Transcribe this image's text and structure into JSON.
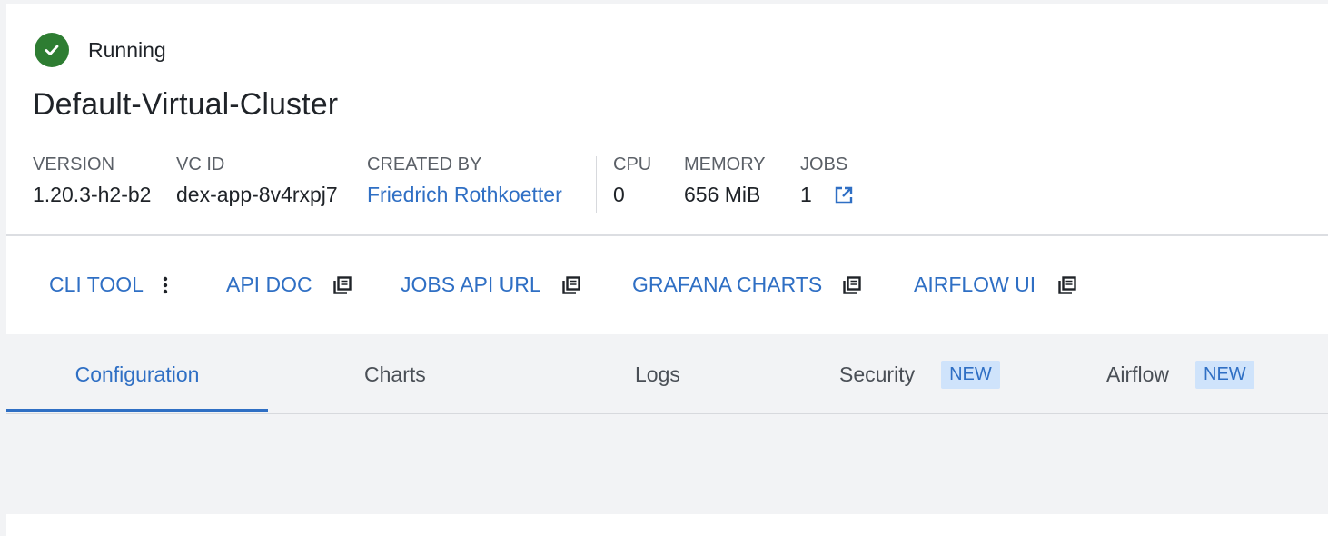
{
  "status": {
    "label": "Running",
    "icon": "check-circle-icon",
    "color": "#2e7d32"
  },
  "cluster": {
    "name": "Default-Virtual-Cluster"
  },
  "meta": {
    "version": {
      "label": "VERSION",
      "value": "1.20.3-h2-b2"
    },
    "vc_id": {
      "label": "VC ID",
      "value": "dex-app-8v4rxpj7"
    },
    "created_by": {
      "label": "CREATED BY",
      "value": "Friedrich Rothkoetter"
    },
    "cpu": {
      "label": "CPU",
      "value": "0"
    },
    "memory": {
      "label": "MEMORY",
      "value": "656 MiB"
    },
    "jobs": {
      "label": "JOBS",
      "value": "1",
      "icon": "external-link-icon"
    }
  },
  "actions": [
    {
      "label": "CLI TOOL",
      "icon": "more-vertical-icon"
    },
    {
      "label": "API DOC",
      "icon": "copy-icon"
    },
    {
      "label": "JOBS API URL",
      "icon": "copy-icon"
    },
    {
      "label": "GRAFANA CHARTS",
      "icon": "copy-icon"
    },
    {
      "label": "AIRFLOW UI",
      "icon": "copy-icon"
    }
  ],
  "tabs": [
    {
      "label": "Configuration",
      "active": true
    },
    {
      "label": "Charts"
    },
    {
      "label": "Logs"
    },
    {
      "label": "Security",
      "badge": "NEW"
    },
    {
      "label": "Airflow",
      "badge": "NEW"
    }
  ],
  "colors": {
    "accent": "#2f6fc4",
    "badge_bg": "#cfe3fb",
    "success": "#2e7d32"
  }
}
